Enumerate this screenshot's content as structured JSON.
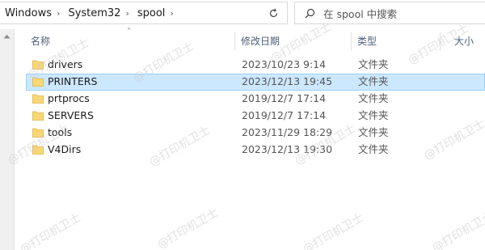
{
  "address_bar": {
    "breadcrumbs": [
      "Windows",
      "System32",
      "spool"
    ]
  },
  "search": {
    "placeholder": "在 spool 中搜索"
  },
  "columns": {
    "name": "名称",
    "date": "修改日期",
    "type": "类型",
    "size": "大小"
  },
  "files": [
    {
      "name": "drivers",
      "date": "2023/10/23 9:14",
      "type": "文件夹",
      "selected": false
    },
    {
      "name": "PRINTERS",
      "date": "2023/12/13 19:45",
      "type": "文件夹",
      "selected": true
    },
    {
      "name": "prtprocs",
      "date": "2019/12/7 17:14",
      "type": "文件夹",
      "selected": false
    },
    {
      "name": "SERVERS",
      "date": "2019/12/7 17:14",
      "type": "文件夹",
      "selected": false
    },
    {
      "name": "tools",
      "date": "2023/11/29 18:29",
      "type": "文件夹",
      "selected": false
    },
    {
      "name": "V4Dirs",
      "date": "2023/12/13 19:30",
      "type": "文件夹",
      "selected": false
    }
  ],
  "watermark": "@打印机卫士",
  "colors": {
    "selection_bg": "#cce8ff",
    "selection_border": "#99d1ff",
    "folder": "#f8d775",
    "header_text": "#4c607a"
  }
}
